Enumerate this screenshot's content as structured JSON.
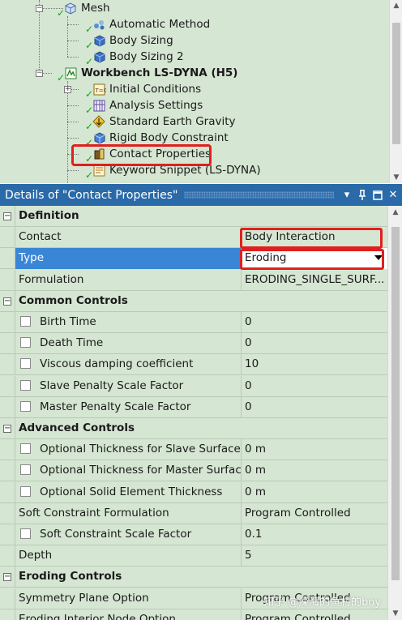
{
  "tree": {
    "items": [
      {
        "label": "Mesh",
        "icon": "mesh-icon",
        "bold": false
      },
      {
        "label": "Automatic Method",
        "icon": "automatic-method-icon",
        "bold": false
      },
      {
        "label": "Body Sizing",
        "icon": "body-sizing-icon",
        "bold": false
      },
      {
        "label": "Body Sizing 2",
        "icon": "body-sizing-icon",
        "bold": false
      },
      {
        "label": "Workbench LS-DYNA (H5)",
        "icon": "ls-dyna-analysis-icon",
        "bold": true
      },
      {
        "label": "Initial Conditions",
        "icon": "initial-conditions-icon",
        "bold": false
      },
      {
        "label": "Analysis Settings",
        "icon": "analysis-settings-icon",
        "bold": false
      },
      {
        "label": "Standard Earth Gravity",
        "icon": "gravity-icon",
        "bold": false
      },
      {
        "label": "Rigid Body Constraint",
        "icon": "rigid-body-constraint-icon",
        "bold": false
      },
      {
        "label": "Contact Properties",
        "icon": "contact-properties-icon",
        "bold": false
      },
      {
        "label": "Keyword Snippet (LS-DYNA)",
        "icon": "keyword-snippet-icon",
        "bold": false
      }
    ],
    "status_color": "#1aa31a"
  },
  "details": {
    "title": "Details of \"Contact Properties\"",
    "header_color": "#2a6aa8",
    "rows": [
      {
        "kind": "section",
        "name": "Definition"
      },
      {
        "kind": "prop",
        "name": "Contact",
        "value": "Body Interaction"
      },
      {
        "kind": "prop",
        "name": "Type",
        "value": "Eroding",
        "selected": true
      },
      {
        "kind": "prop",
        "name": "Formulation",
        "value": "ERODING_SINGLE_SURF..."
      },
      {
        "kind": "section",
        "name": "Common Controls"
      },
      {
        "kind": "prop",
        "name": "Birth Time",
        "value": "0",
        "checkbox": true
      },
      {
        "kind": "prop",
        "name": "Death Time",
        "value": "0",
        "checkbox": true
      },
      {
        "kind": "prop",
        "name": "Viscous damping coefficient",
        "value": "10",
        "checkbox": true
      },
      {
        "kind": "prop",
        "name": "Slave Penalty Scale Factor",
        "value": "0",
        "checkbox": true
      },
      {
        "kind": "prop",
        "name": "Master Penalty Scale Factor",
        "value": "0",
        "checkbox": true
      },
      {
        "kind": "section",
        "name": "Advanced Controls"
      },
      {
        "kind": "prop",
        "name": "Optional Thickness for Slave Surface",
        "value": "0 m",
        "checkbox": true
      },
      {
        "kind": "prop",
        "name": "Optional Thickness for Master Surface",
        "value": "0 m",
        "checkbox": true
      },
      {
        "kind": "prop",
        "name": "Optional Solid Element Thickness",
        "value": "0 m",
        "checkbox": true
      },
      {
        "kind": "prop",
        "name": "Soft Constraint Formulation",
        "value": "Program Controlled"
      },
      {
        "kind": "prop",
        "name": "Soft Constraint Scale Factor",
        "value": "0.1",
        "checkbox": true
      },
      {
        "kind": "prop",
        "name": "Depth",
        "value": "5"
      },
      {
        "kind": "section",
        "name": "Eroding Controls"
      },
      {
        "kind": "prop",
        "name": "Symmetry Plane Option",
        "value": "Program Controlled"
      },
      {
        "kind": "prop",
        "name": "Eroding Interior Node Option",
        "value": "Program Controlled"
      }
    ]
  },
  "watermark": "知乎 @深海的鱼村的boy",
  "highlight_color": "#e0201e"
}
